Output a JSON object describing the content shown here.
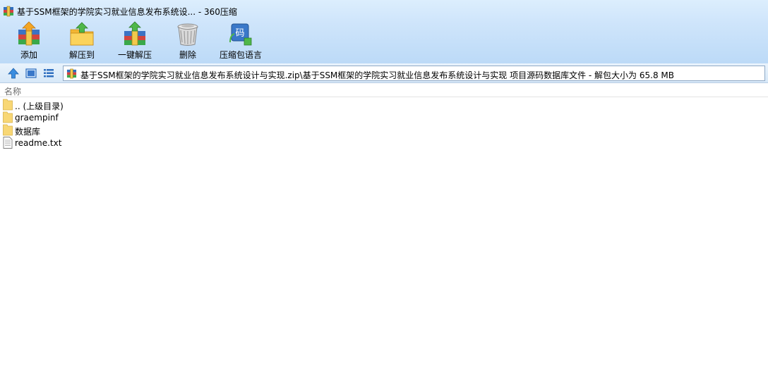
{
  "window": {
    "title": "基于SSM框架的学院实习就业信息发布系统设... - 360压缩"
  },
  "toolbar": {
    "buttons": [
      {
        "id": "add",
        "label": "添加",
        "icon": "add-archive-icon"
      },
      {
        "id": "extract-to",
        "label": "解压到",
        "icon": "extract-to-folder-icon"
      },
      {
        "id": "one-click-extract",
        "label": "一键解压",
        "icon": "one-click-extract-icon"
      },
      {
        "id": "delete",
        "label": "删除",
        "icon": "trash-can-icon"
      },
      {
        "id": "language",
        "label": "压缩包语言",
        "icon": "encoding-icon",
        "glyph": "码"
      }
    ]
  },
  "nav": {
    "address": "基于SSM框架的学院实习就业信息发布系统设计与实现.zip\\基于SSM框架的学院实习就业信息发布系统设计与实现 项目源码数据库文件 - 解包大小为 65.8 MB"
  },
  "list": {
    "column_name": "名称",
    "items": [
      {
        "name": ".. (上级目录)",
        "type": "folder"
      },
      {
        "name": "graempinf",
        "type": "folder"
      },
      {
        "name": "数据库",
        "type": "folder"
      },
      {
        "name": "readme.txt",
        "type": "file"
      }
    ]
  },
  "colors": {
    "toolbar_top": "#dceefd",
    "toolbar_bottom": "#bcdaf7",
    "folder": "#f8d775",
    "accent": "#3a78c9"
  }
}
